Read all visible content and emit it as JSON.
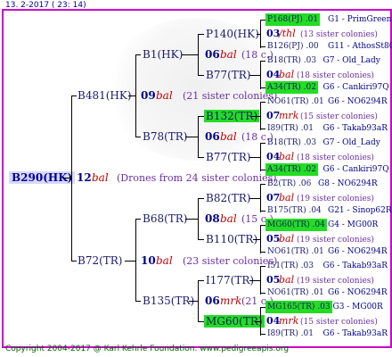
{
  "header": "13. 2-2017 ( 23: 14)",
  "footer": "Copyright 2004-2017 @ Karl Kehrle Foundation.   www.pedigreeapis.org",
  "root": {
    "name": "B290(HK)",
    "num": "12",
    "mark": "bal",
    "note": "(Drones from 24 sister colonies)"
  },
  "g1": [
    {
      "name": "B481(HK)",
      "num": "09",
      "mark": "bal",
      "note": "(21 sister colonies)"
    },
    {
      "name": "B72(TR)",
      "num": "10",
      "mark": "bal",
      "note": "(23 sister colonies)"
    }
  ],
  "g2": [
    {
      "name": "B1(HK)",
      "num": "06",
      "mark": "bal",
      "note": "(18 c.)"
    },
    {
      "name": "B78(TR)",
      "num": "06",
      "mark": "bal",
      "note": "(18 c.)"
    },
    {
      "name": "B68(TR)",
      "num": "08",
      "mark": "bal",
      "note": "(15 c.)"
    },
    {
      "name": "B135(TR)",
      "num": "06",
      "mark": "mrk",
      "note": "(21 c.)"
    }
  ],
  "g3": [
    {
      "name": "P140(HK)",
      "num": "03",
      "mark": "/thl",
      "note": "(13 sister colonies)"
    },
    {
      "name": "B77(TR)",
      "num": "04",
      "mark": "bal",
      "note": "(18 sister colonies)"
    },
    {
      "name": "B132(TR)",
      "num": "07",
      "mark": "mrk",
      "note": "(15 sister colonies)"
    },
    {
      "name": "B77(TR)",
      "num": "04",
      "mark": "bal",
      "note": "(18 sister colonies)"
    },
    {
      "name": "B82(TR)",
      "num": "07",
      "mark": "bal",
      "note": "(19 sister colonies)"
    },
    {
      "name": "B110(TR)",
      "num": "05",
      "mark": "bal",
      "note": "(19 sister colonies)"
    },
    {
      "name": "I177(TR)",
      "num": "05",
      "mark": "bal",
      "note": "(19 sister colonies)"
    },
    {
      "name": "MG60(TR)",
      "num": "04",
      "mark": "mrk",
      "note": "(15 sister colonies)"
    }
  ],
  "g4": [
    {
      "name": "P168(PJ) .01",
      "tag": "G1 - PrimGreen00"
    },
    {
      "name": "B126(PJ) .00",
      "tag": "G11 - AthosSt80R"
    },
    {
      "name": "B18(TR) .03",
      "tag": "G7 - Old_Lady"
    },
    {
      "name": "A34(TR) .02",
      "tag": "G6 - Cankiri97Q"
    },
    {
      "name": "NO61(TR) .01",
      "tag": "G6 - NO6294R"
    },
    {
      "name": "I89(TR) .01",
      "tag": "G6 - Takab93aR"
    },
    {
      "name": "B18(TR) .03",
      "tag": "G7 - Old_Lady"
    },
    {
      "name": "A34(TR) .02",
      "tag": "G6 - Cankiri97Q"
    },
    {
      "name": "B2(TR) .06",
      "tag": "G8 - NO6294R"
    },
    {
      "name": "B175(TR) .04",
      "tag": "G21 - Sinop62R"
    },
    {
      "name": "MG60(TR) .04",
      "tag": "G4 - MG00R"
    },
    {
      "name": "NO61(TR) .01",
      "tag": "G6 - NO6294R"
    },
    {
      "name": "I51(TR) .03",
      "tag": "G6 - Takab93aR"
    },
    {
      "name": "NO61(TR) .01",
      "tag": "G6 - NO6294R"
    },
    {
      "name": "MG165(TR) .03",
      "tag": "G3 - MG00R"
    },
    {
      "name": "I89(TR) .01",
      "tag": "G6 - Takab93aR"
    }
  ]
}
